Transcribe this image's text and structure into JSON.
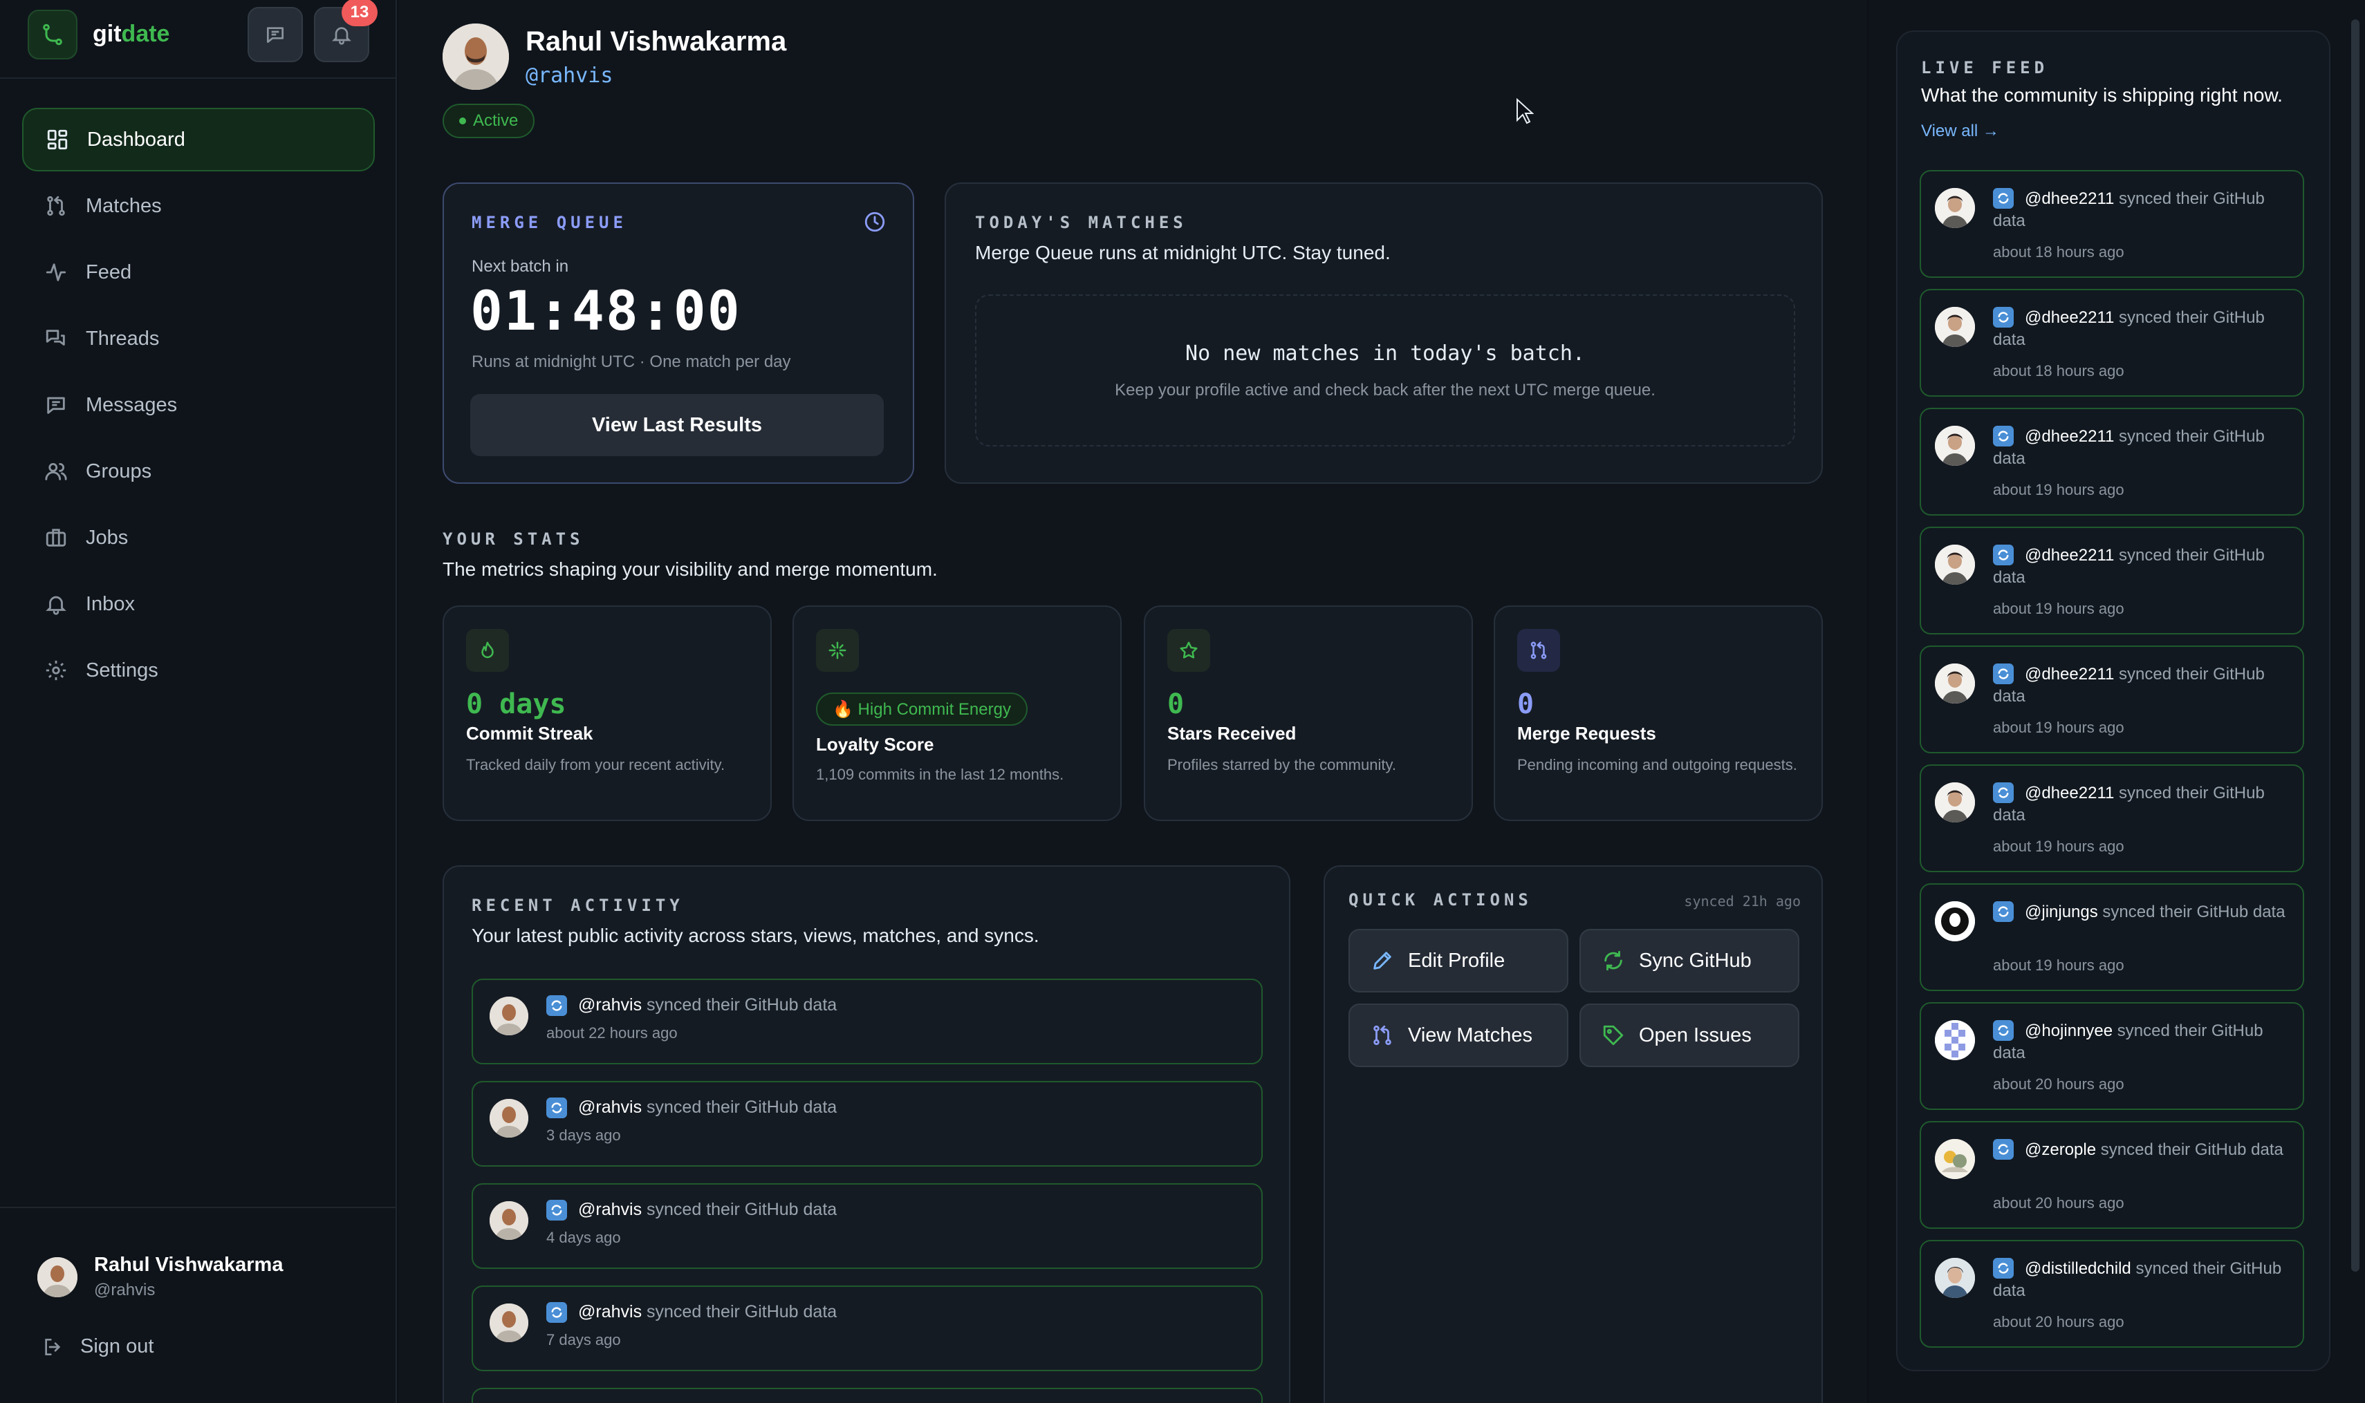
{
  "brand": {
    "name_part1": "git",
    "name_part2": "date"
  },
  "header": {
    "notifications_count": "13"
  },
  "colors": {
    "accent_green": "#3fb950",
    "accent_blue": "#8b9cf7",
    "badge_red": "#f05a5a",
    "bg": "#0d1117"
  },
  "sidebar": {
    "items": [
      {
        "label": "Dashboard",
        "icon": "dashboard-icon",
        "active": true
      },
      {
        "label": "Matches",
        "icon": "merge-icon"
      },
      {
        "label": "Feed",
        "icon": "activity-icon"
      },
      {
        "label": "Threads",
        "icon": "threads-icon"
      },
      {
        "label": "Messages",
        "icon": "message-icon"
      },
      {
        "label": "Groups",
        "icon": "users-icon"
      },
      {
        "label": "Jobs",
        "icon": "briefcase-icon"
      },
      {
        "label": "Inbox",
        "icon": "bell-icon"
      },
      {
        "label": "Settings",
        "icon": "gear-icon"
      }
    ],
    "user": {
      "name": "Rahul Vishwakarma",
      "handle": "@rahvis"
    },
    "signout_label": "Sign out"
  },
  "profile": {
    "name": "Rahul Vishwakarma",
    "handle": "@rahvis",
    "status": "Active"
  },
  "merge_queue": {
    "title": "MERGE QUEUE",
    "next_label": "Next batch in",
    "countdown": "01:48:00",
    "runs_text": "Runs at midnight UTC · One match per day",
    "button_label": "View Last Results"
  },
  "todays_matches": {
    "title": "TODAY'S MATCHES",
    "subtitle": "Merge Queue runs at midnight UTC. Stay tuned.",
    "empty_title": "No new matches in today's batch.",
    "empty_desc": "Keep your profile active and check back after the next UTC merge queue."
  },
  "stats": {
    "title": "YOUR STATS",
    "subtitle": "The metrics shaping your visibility and merge momentum.",
    "cards": [
      {
        "value": "0 days",
        "title": "Commit Streak",
        "desc": "Tracked daily from your recent activity.",
        "icon": "flame-icon"
      },
      {
        "badge": "🔥 High Commit Energy",
        "title": "Loyalty Score",
        "desc": "1,109 commits in the last 12 months.",
        "icon": "sparkle-icon"
      },
      {
        "value": "0",
        "title": "Stars Received",
        "desc": "Profiles starred by the community.",
        "icon": "star-icon"
      },
      {
        "value": "0",
        "title": "Merge Requests",
        "desc": "Pending incoming and outgoing requests.",
        "icon": "merge-icon"
      }
    ]
  },
  "recent_activity": {
    "title": "RECENT ACTIVITY",
    "subtitle": "Your latest public activity across stars, views, matches, and syncs.",
    "items": [
      {
        "user": "@rahvis",
        "action": "synced their GitHub data",
        "time": "about 22 hours ago"
      },
      {
        "user": "@rahvis",
        "action": "synced their GitHub data",
        "time": "3 days ago"
      },
      {
        "user": "@rahvis",
        "action": "synced their GitHub data",
        "time": "4 days ago"
      },
      {
        "user": "@rahvis",
        "action": "synced their GitHub data",
        "time": "7 days ago"
      }
    ]
  },
  "quick_actions": {
    "title": "QUICK ACTIONS",
    "synced": "synced 21h ago",
    "buttons": [
      {
        "label": "Edit Profile",
        "icon": "pencil-icon"
      },
      {
        "label": "Sync GitHub",
        "icon": "refresh-icon"
      },
      {
        "label": "View Matches",
        "icon": "merge-icon"
      },
      {
        "label": "Open Issues",
        "icon": "tag-icon"
      }
    ]
  },
  "live_feed": {
    "title": "LIVE FEED",
    "subtitle": "What the community is shipping right now.",
    "view_all": "View all →",
    "items": [
      {
        "user": "@dhee2211",
        "action": "synced their GitHub data",
        "time": "about 18 hours ago"
      },
      {
        "user": "@dhee2211",
        "action": "synced their GitHub data",
        "time": "about 18 hours ago"
      },
      {
        "user": "@dhee2211",
        "action": "synced their GitHub data",
        "time": "about 19 hours ago"
      },
      {
        "user": "@dhee2211",
        "action": "synced their GitHub data",
        "time": "about 19 hours ago"
      },
      {
        "user": "@dhee2211",
        "action": "synced their GitHub data",
        "time": "about 19 hours ago"
      },
      {
        "user": "@dhee2211",
        "action": "synced their GitHub data",
        "time": "about 19 hours ago"
      },
      {
        "user": "@jinjungs",
        "action": "synced their GitHub data",
        "time": "about 19 hours ago"
      },
      {
        "user": "@hojinnyee",
        "action": "synced their GitHub data",
        "time": "about 20 hours ago"
      },
      {
        "user": "@zerople",
        "action": "synced their GitHub data",
        "time": "about 20 hours ago"
      },
      {
        "user": "@distilledchild",
        "action": "synced their GitHub data",
        "time": "about 20 hours ago"
      }
    ]
  }
}
